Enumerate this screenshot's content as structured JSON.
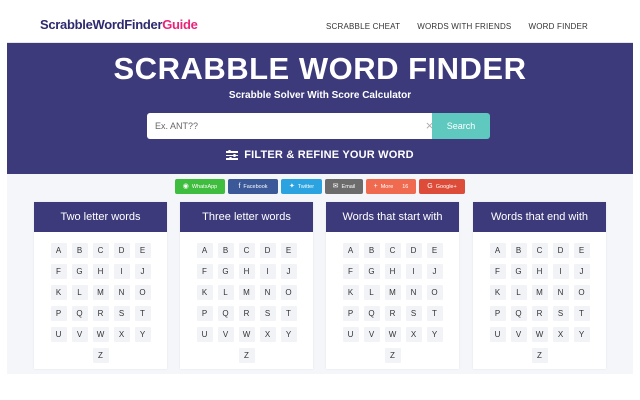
{
  "header": {
    "logo_main": "ScrabbleWordFinder",
    "logo_accent": "Guide",
    "nav": [
      "SCRABBLE CHEAT",
      "WORDS WITH FRIENDS",
      "WORD FINDER"
    ]
  },
  "hero": {
    "title": "SCRABBLE WORD FINDER",
    "subtitle": "Scrabble Solver With Score Calculator",
    "search_placeholder": "Ex. ANT??",
    "clear_glyph": "×",
    "search_button": "Search",
    "filter_label": "FILTER & REFINE YOUR WORD"
  },
  "share": [
    {
      "label": "WhatsApp",
      "icon": "whatsapp-icon",
      "glyph": "◉",
      "color": "#3fbd3e",
      "width": 50
    },
    {
      "label": "Facebook",
      "icon": "facebook-icon",
      "glyph": "f",
      "color": "#3b5998",
      "width": 50
    },
    {
      "label": "Twitter",
      "icon": "twitter-icon",
      "glyph": "✦",
      "color": "#2ba3e0",
      "width": 41
    },
    {
      "label": "Email",
      "icon": "email-icon",
      "glyph": "✉",
      "color": "#6c6c6c",
      "width": 38
    },
    {
      "label": "More",
      "icon": "plus-icon",
      "glyph": "+",
      "count": "16",
      "color": "#ef6a4f",
      "width": 50
    },
    {
      "label": "Google+",
      "icon": "google-plus-icon",
      "glyph": "G",
      "color": "#dd4b39",
      "width": 46
    }
  ],
  "cards": [
    {
      "title": "Two letter words",
      "id": "two-letter-words"
    },
    {
      "title": "Three letter words",
      "id": "three-letter-words"
    },
    {
      "title": "Words that start with",
      "id": "words-start-with"
    },
    {
      "title": "Words that end with",
      "id": "words-end-with"
    }
  ],
  "letters": [
    "A",
    "B",
    "C",
    "D",
    "E",
    "F",
    "G",
    "H",
    "I",
    "J",
    "K",
    "L",
    "M",
    "N",
    "O",
    "P",
    "Q",
    "R",
    "S",
    "T",
    "U",
    "V",
    "W",
    "X",
    "Y",
    "Z"
  ],
  "colors": {
    "brand_dark": "#3d3a7c",
    "accent_pink": "#e8247a",
    "search_button": "#5fc9bf",
    "background_light": "#f4f6f9"
  }
}
